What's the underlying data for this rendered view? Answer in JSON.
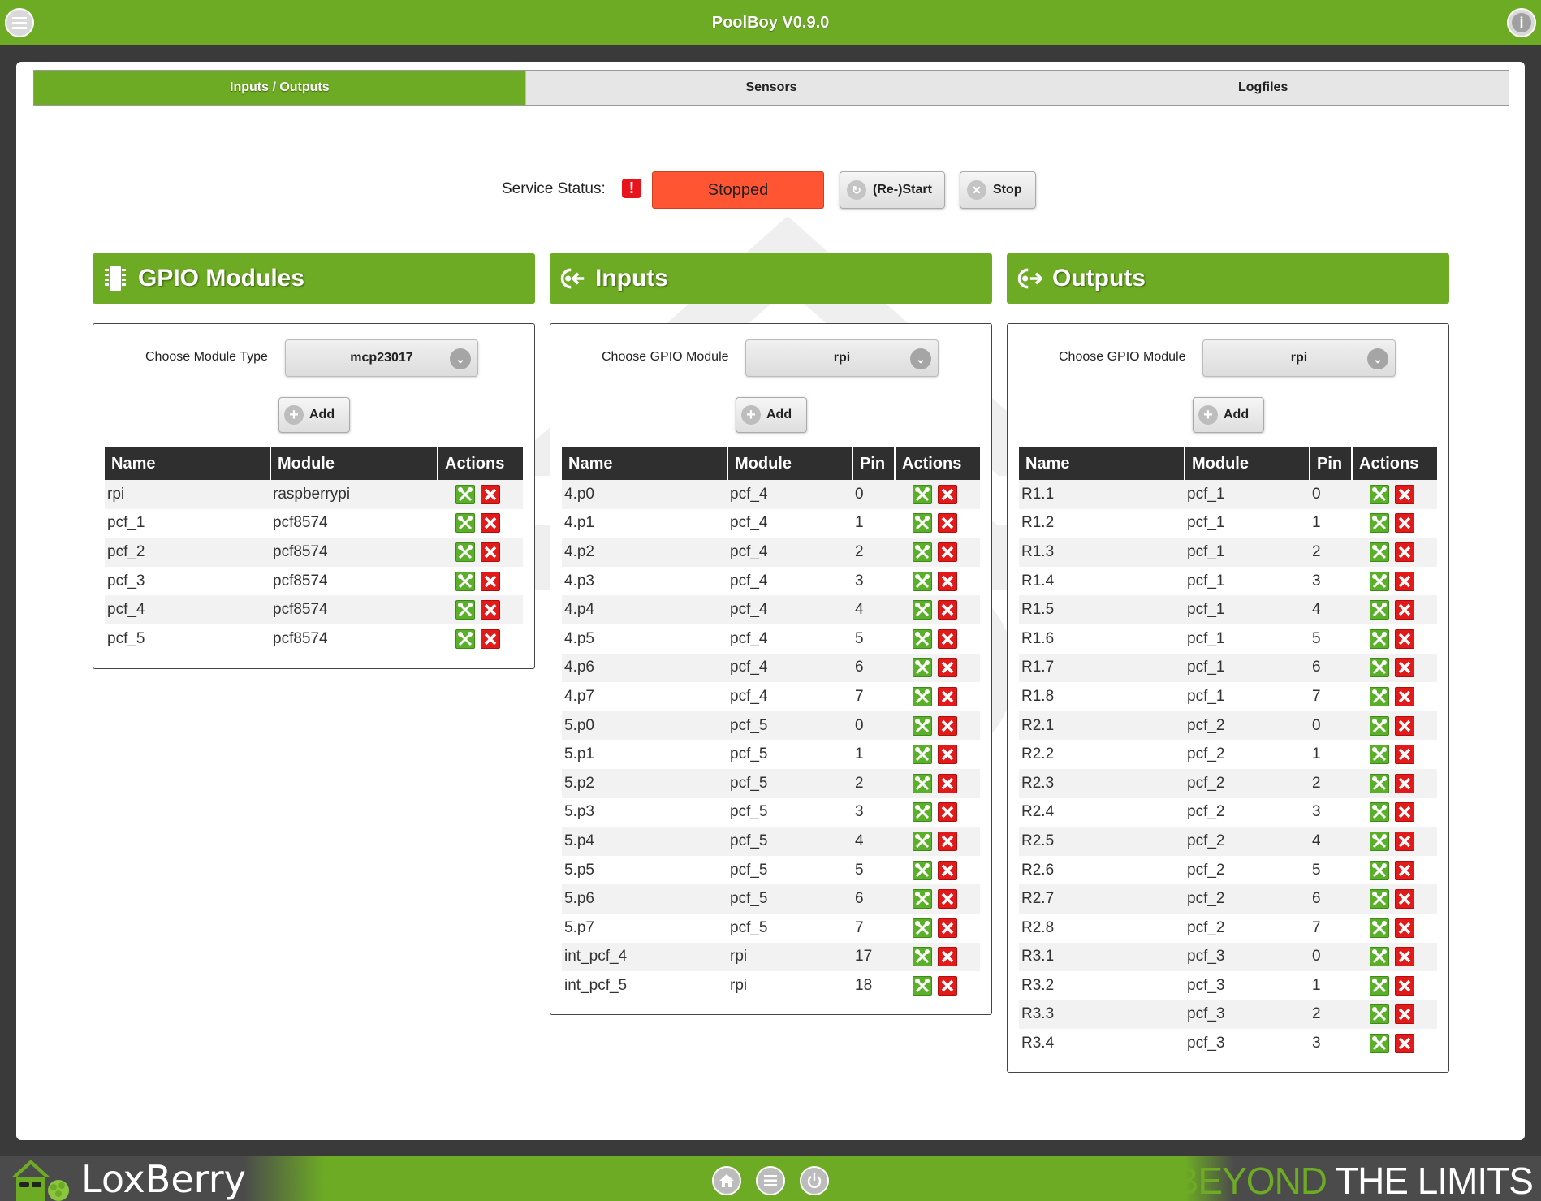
{
  "app": {
    "title": "PoolBoy V0.9.0"
  },
  "colors": {
    "brand": "#6dab24",
    "stopped": "#ff5533",
    "edit": "#5bb02a",
    "delete": "#e21a1a"
  },
  "header": {
    "menu_icon": "menu-icon",
    "info_icon": "info-icon",
    "info_glyph": "i"
  },
  "tabs": [
    {
      "label": "Inputs / Outputs",
      "active": true
    },
    {
      "label": "Sensors",
      "active": false
    },
    {
      "label": "Logfiles",
      "active": false
    }
  ],
  "service": {
    "label": "Service Status:",
    "alert_glyph": "!",
    "status": "Stopped",
    "restart_label": "(Re-)Start",
    "stop_label": "Stop"
  },
  "gpio_modules": {
    "title": "GPIO Modules",
    "choose_label": "Choose Module Type",
    "selected": "mcp23017",
    "add_label": "Add",
    "columns": [
      "Name",
      "Module",
      "Actions"
    ],
    "rows": [
      {
        "name": "rpi",
        "module": "raspberrypi"
      },
      {
        "name": "pcf_1",
        "module": "pcf8574"
      },
      {
        "name": "pcf_2",
        "module": "pcf8574"
      },
      {
        "name": "pcf_3",
        "module": "pcf8574"
      },
      {
        "name": "pcf_4",
        "module": "pcf8574"
      },
      {
        "name": "pcf_5",
        "module": "pcf8574"
      }
    ]
  },
  "inputs": {
    "title": "Inputs",
    "choose_label": "Choose GPIO Module",
    "selected": "rpi",
    "add_label": "Add",
    "columns": [
      "Name",
      "Module",
      "Pin",
      "Actions"
    ],
    "rows": [
      {
        "name": "4.p0",
        "module": "pcf_4",
        "pin": "0"
      },
      {
        "name": "4.p1",
        "module": "pcf_4",
        "pin": "1"
      },
      {
        "name": "4.p2",
        "module": "pcf_4",
        "pin": "2"
      },
      {
        "name": "4.p3",
        "module": "pcf_4",
        "pin": "3"
      },
      {
        "name": "4.p4",
        "module": "pcf_4",
        "pin": "4"
      },
      {
        "name": "4.p5",
        "module": "pcf_4",
        "pin": "5"
      },
      {
        "name": "4.p6",
        "module": "pcf_4",
        "pin": "6"
      },
      {
        "name": "4.p7",
        "module": "pcf_4",
        "pin": "7"
      },
      {
        "name": "5.p0",
        "module": "pcf_5",
        "pin": "0"
      },
      {
        "name": "5.p1",
        "module": "pcf_5",
        "pin": "1"
      },
      {
        "name": "5.p2",
        "module": "pcf_5",
        "pin": "2"
      },
      {
        "name": "5.p3",
        "module": "pcf_5",
        "pin": "3"
      },
      {
        "name": "5.p4",
        "module": "pcf_5",
        "pin": "4"
      },
      {
        "name": "5.p5",
        "module": "pcf_5",
        "pin": "5"
      },
      {
        "name": "5.p6",
        "module": "pcf_5",
        "pin": "6"
      },
      {
        "name": "5.p7",
        "module": "pcf_5",
        "pin": "7"
      },
      {
        "name": "int_pcf_4",
        "module": "rpi",
        "pin": "17"
      },
      {
        "name": "int_pcf_5",
        "module": "rpi",
        "pin": "18"
      }
    ]
  },
  "outputs": {
    "title": "Outputs",
    "choose_label": "Choose GPIO Module",
    "selected": "rpi",
    "add_label": "Add",
    "columns": [
      "Name",
      "Module",
      "Pin",
      "Actions"
    ],
    "rows": [
      {
        "name": "R1.1",
        "module": "pcf_1",
        "pin": "0"
      },
      {
        "name": "R1.2",
        "module": "pcf_1",
        "pin": "1"
      },
      {
        "name": "R1.3",
        "module": "pcf_1",
        "pin": "2"
      },
      {
        "name": "R1.4",
        "module": "pcf_1",
        "pin": "3"
      },
      {
        "name": "R1.5",
        "module": "pcf_1",
        "pin": "4"
      },
      {
        "name": "R1.6",
        "module": "pcf_1",
        "pin": "5"
      },
      {
        "name": "R1.7",
        "module": "pcf_1",
        "pin": "6"
      },
      {
        "name": "R1.8",
        "module": "pcf_1",
        "pin": "7"
      },
      {
        "name": "R2.1",
        "module": "pcf_2",
        "pin": "0"
      },
      {
        "name": "R2.2",
        "module": "pcf_2",
        "pin": "1"
      },
      {
        "name": "R2.3",
        "module": "pcf_2",
        "pin": "2"
      },
      {
        "name": "R2.4",
        "module": "pcf_2",
        "pin": "3"
      },
      {
        "name": "R2.5",
        "module": "pcf_2",
        "pin": "4"
      },
      {
        "name": "R2.6",
        "module": "pcf_2",
        "pin": "5"
      },
      {
        "name": "R2.7",
        "module": "pcf_2",
        "pin": "6"
      },
      {
        "name": "R2.8",
        "module": "pcf_2",
        "pin": "7"
      },
      {
        "name": "R3.1",
        "module": "pcf_3",
        "pin": "0"
      },
      {
        "name": "R3.2",
        "module": "pcf_3",
        "pin": "1"
      },
      {
        "name": "R3.3",
        "module": "pcf_3",
        "pin": "2"
      },
      {
        "name": "R3.4",
        "module": "pcf_3",
        "pin": "3"
      }
    ]
  },
  "footer": {
    "brand": "LoxBerry",
    "slogan_highlight": "BEYOND",
    "slogan_rest": " THE LIMITS",
    "buttons": [
      "home-icon",
      "menu-icon",
      "power-icon"
    ]
  }
}
